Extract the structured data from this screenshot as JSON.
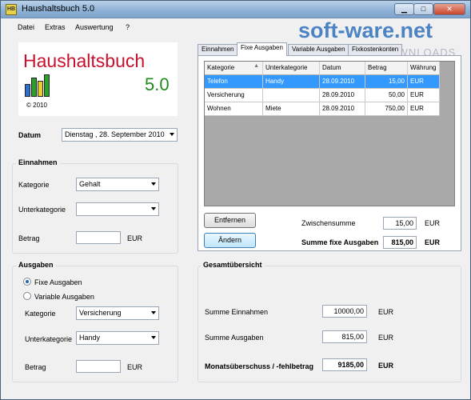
{
  "window": {
    "title": "Haushaltsbuch 5.0",
    "icon_label": "HB",
    "controls": {
      "minimize": "▁",
      "maximize": "□",
      "close": "✕"
    }
  },
  "watermark": {
    "brand": "soft-ware.net",
    "tagline": "AKTUELLE DOWNLOADS"
  },
  "menu": [
    "Datei",
    "Extras",
    "Auswertung",
    "?"
  ],
  "logo": {
    "title": "Haushaltsbuch",
    "version": "5.0",
    "copyright": "© 2010"
  },
  "datum": {
    "label": "Datum",
    "value": "Dienstag  , 28. September 2010"
  },
  "einnahmen": {
    "title": "Einnahmen",
    "kategorie_label": "Kategorie",
    "kategorie_value": "Gehalt",
    "unterkategorie_label": "Unterkategorie",
    "unterkategorie_value": "",
    "betrag_label": "Betrag",
    "betrag_value": "",
    "currency": "EUR"
  },
  "ausgaben": {
    "title": "Ausgaben",
    "radio_fixe": "Fixe Ausgaben",
    "radio_variable": "Variable Ausgaben",
    "kategorie_label": "Kategorie",
    "kategorie_value": "Versicherung",
    "unterkategorie_label": "Unterkategorie",
    "unterkategorie_value": "Handy",
    "betrag_label": "Betrag",
    "betrag_value": "",
    "currency": "EUR"
  },
  "tabs": [
    "Einnahmen",
    "Fixe Ausgaben",
    "Variable Ausgaben",
    "Fixkostenkonten"
  ],
  "table": {
    "headers": [
      "Kategorie",
      "Unterkategorie",
      "Datum",
      "Betrag",
      "Währung"
    ],
    "rows": [
      [
        "Telefon",
        "Handy",
        "28.09.2010",
        "15,00",
        "EUR"
      ],
      [
        "Versicherung",
        "",
        "28.09.2010",
        "50,00",
        "EUR"
      ],
      [
        "Wohnen",
        "Miete",
        "28.09.2010",
        "750,00",
        "EUR"
      ]
    ]
  },
  "actions": {
    "remove": "Entfernen",
    "change": "Ändern"
  },
  "summen": {
    "zwischensumme_label": "Zwischensumme",
    "zwischensumme_value": "15,00",
    "fixe_label": "Summe fixe Ausgaben",
    "fixe_value": "815,00",
    "currency": "EUR"
  },
  "gesamt": {
    "title": "Gesamtübersicht",
    "einnahmen_label": "Summe Einnahmen",
    "einnahmen_value": "10000,00",
    "ausgaben_label": "Summe Ausgaben",
    "ausgaben_value": "815,00",
    "ueberschuss_label": "Monatsüberschuss / -fehlbetrag",
    "ueberschuss_value": "9185,00",
    "currency": "EUR"
  }
}
